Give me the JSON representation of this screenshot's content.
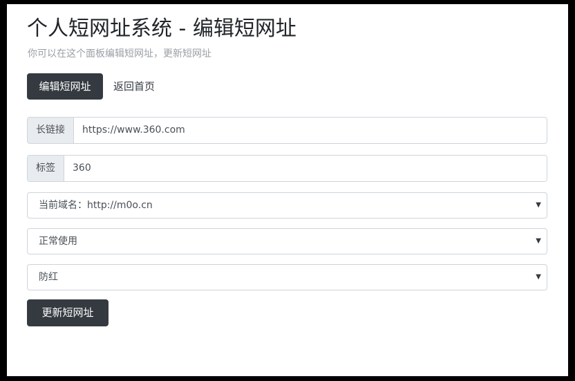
{
  "header": {
    "title": "个人短网址系统 - 编辑短网址",
    "subtitle": "你可以在这个面板编辑短网址，更新短网址"
  },
  "nav": {
    "active_label": "编辑短网址",
    "home_label": "返回首页"
  },
  "form": {
    "long_url": {
      "label": "长链接",
      "value": "https://www.360.com"
    },
    "tag": {
      "label": "标签",
      "value": "360"
    },
    "domain_select": {
      "value": "当前域名：http://m0o.cn"
    },
    "status_select": {
      "value": "正常使用"
    },
    "protection_select": {
      "value": "防红"
    },
    "submit_label": "更新短网址"
  },
  "icons": {
    "select_caret": "caret-down-icon"
  },
  "colors": {
    "dark_button": "#343a40",
    "addon_bg": "#e9ecef",
    "border": "#ced4da"
  }
}
